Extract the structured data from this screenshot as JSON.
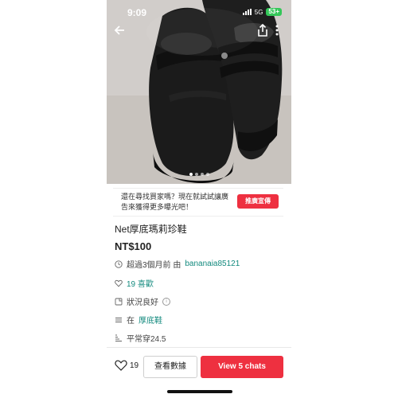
{
  "status_bar": {
    "time": "9:09",
    "network": "5G",
    "battery": "53+"
  },
  "listing": {
    "title": "Net厚底瑪莉珍鞋",
    "price": "NT$100",
    "posted_text": "超過3個月前 由",
    "seller": "bananaia85121",
    "likes_text": "19 喜歡",
    "condition": "狀況良好",
    "category_prefix": "在",
    "category": "厚底鞋",
    "size": "平常穿24.5"
  },
  "ad": {
    "text": "還在尋找買家嗎？現在就試試讓廣告來獲得更多曝光吧！",
    "button": "推廣宣傳"
  },
  "bottom_bar": {
    "like_count": "19",
    "stats_button": "查看數據",
    "chat_button": "View 5 chats"
  },
  "colors": {
    "accent": "#ee3040",
    "link": "#138a7e"
  },
  "icons": [
    "back-arrow-icon",
    "share-icon",
    "more-icon",
    "clock-icon",
    "heart-icon",
    "tag-icon",
    "info-icon",
    "list-icon",
    "ruler-icon"
  ]
}
